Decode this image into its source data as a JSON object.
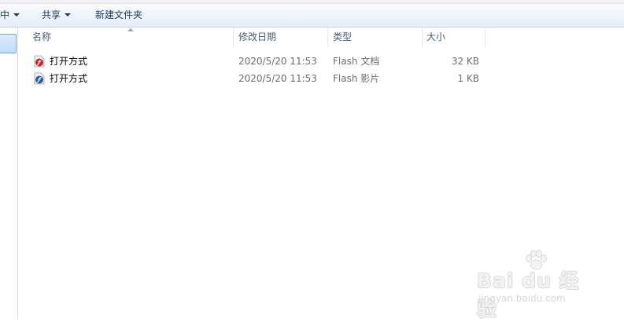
{
  "toolbar": {
    "item0_label": "中",
    "share_label": "共享",
    "new_folder_label": "新建文件夹"
  },
  "columns": {
    "name": "名称",
    "date": "修改日期",
    "type": "类型",
    "size": "大小"
  },
  "files": [
    {
      "name": "打开方式",
      "date": "2020/5/20 11:53",
      "type": "Flash 文档",
      "size": "32 KB",
      "icon": "flash-document-icon"
    },
    {
      "name": "打开方式",
      "date": "2020/5/20 11:53",
      "type": "Flash 影片",
      "size": "1 KB",
      "icon": "flash-movie-icon"
    }
  ],
  "watermark": {
    "brand": "Bai du 经验",
    "url": "jingyan.baidu.com"
  },
  "colors": {
    "toolbar_text": "#1e395b",
    "header_text": "#4c607a",
    "meta_text": "#6d6d6d",
    "selection": "#c1dcfc"
  }
}
